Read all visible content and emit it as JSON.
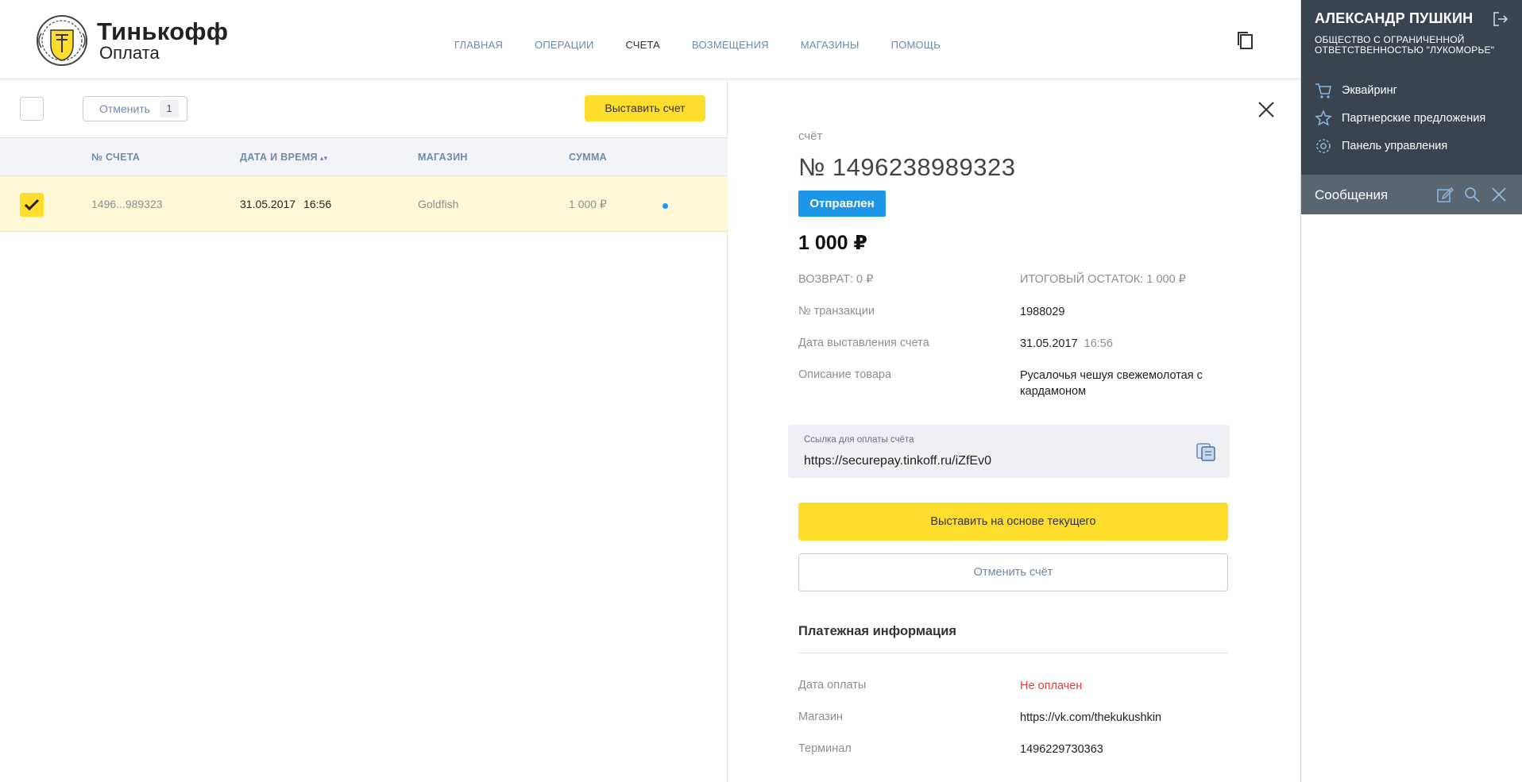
{
  "header": {
    "brand": "Тинькофф",
    "brand_sub": "Оплата",
    "nav": [
      {
        "label": "ГЛАВНАЯ",
        "active": false
      },
      {
        "label": "ОПЕРАЦИИ",
        "active": false
      },
      {
        "label": "СЧЕТА",
        "active": true
      },
      {
        "label": "ВОЗМЕЩЕНИЯ",
        "active": false
      },
      {
        "label": "МАГАЗИНЫ",
        "active": false
      },
      {
        "label": "ПОМОЩЬ",
        "active": false
      }
    ]
  },
  "toolbar": {
    "cancel_label": "Отменить",
    "cancel_count": "1",
    "issue_label": "Выставить счет"
  },
  "table": {
    "columns": [
      "№ СЧЕТА",
      "ДАТА И ВРЕМЯ",
      "МАГАЗИН",
      "СУММА"
    ],
    "rows": [
      {
        "id": "1496...989323",
        "date": "31.05.2017",
        "time": "16:56",
        "shop": "Goldfish",
        "sum": "1 000 ₽",
        "checked": true
      }
    ]
  },
  "detail": {
    "kicker": "счёт",
    "number": "№ 1496238989323",
    "status": "Отправлен",
    "amount": "1 000 ₽",
    "refund": "ВОЗВРАТ: 0 ₽",
    "balance": "ИТОГОВЫЙ ОСТАТОК: 1 000 ₽",
    "fields": [
      {
        "label": "№ транзакции",
        "value": "1988029"
      },
      {
        "label": "Дата выставления счета",
        "value": "31.05.2017",
        "value_extra": "16:56"
      },
      {
        "label": "Описание товара",
        "value": "Русалочья чешуя свежемолотая с кардамоном"
      }
    ],
    "link_label": "Ссылка для оплаты счёта",
    "link_value": "https://securepay.tinkoff.ru/iZfEv0",
    "primary_button": "Выставить на основе текущего",
    "secondary_button": "Отменить счёт",
    "payment_title": "Платежная информация",
    "payment_fields": [
      {
        "label": "Дата оплаты",
        "value": "Не оплачен"
      },
      {
        "label": "Магазин",
        "value": "https://vk.com/thekukushkin"
      },
      {
        "label": "Терминал",
        "value": "1496229730363"
      }
    ]
  },
  "sidebar": {
    "user_name": "АЛЕКСАНДР ПУШКИН",
    "company": "ОБЩЕСТВО С ОГРАНИЧЕННОЙ ОТВЕТСТВЕННОСТЬЮ \"ЛУКОМОРЬЕ\"",
    "menu": [
      {
        "label": "Эквайринг",
        "icon": "cart-icon"
      },
      {
        "label": "Партнерские предложения",
        "icon": "star-icon"
      },
      {
        "label": "Панель управления",
        "icon": "gear-icon"
      }
    ],
    "messages_title": "Сообщения"
  },
  "colors": {
    "accent_yellow": "#ffdd2d",
    "status_blue": "#1e96e8",
    "sidebar_dark": "#3a4450",
    "link_blue": "#6d8aad",
    "unpaid_red": "#e03e3e"
  }
}
